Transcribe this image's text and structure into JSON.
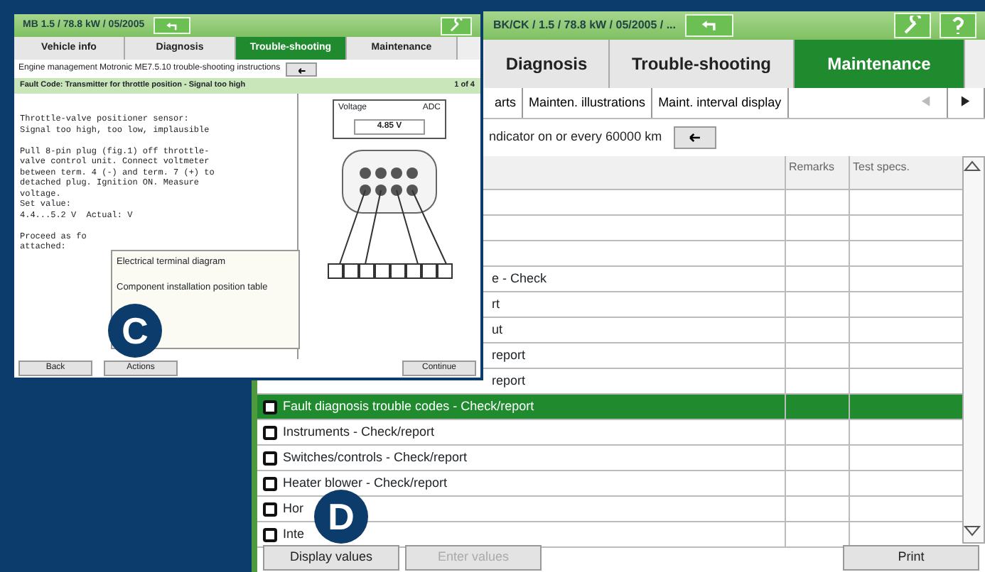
{
  "back_window": {
    "title": "BK/CK / 1.5 / 78.8 kW / 05/2005 / ...",
    "tabs": [
      {
        "label": "Diagnosis",
        "selected": false
      },
      {
        "label": "Trouble-shooting",
        "selected": false
      },
      {
        "label": "Maintenance",
        "selected": true
      }
    ],
    "subtabs": [
      {
        "label": "arts",
        "selected": false
      },
      {
        "label": "Mainten. illustrations",
        "selected": false
      },
      {
        "label": "Maint. interval display",
        "selected": false
      }
    ],
    "instruction": "ndicator on or every 60000 km",
    "table": {
      "columns": [
        "Remarks",
        "Test specs."
      ],
      "rows": [
        {
          "text": "e - Check",
          "partial": true,
          "selected": false
        },
        {
          "text": "rt",
          "partial": true,
          "selected": false
        },
        {
          "text": "ut",
          "partial": true,
          "selected": false
        },
        {
          "text": "report",
          "partial": true,
          "selected": false
        },
        {
          "text": "report",
          "partial": true,
          "selected": false
        },
        {
          "text": "Fault diagnosis trouble codes - Check/report",
          "partial": false,
          "selected": true
        },
        {
          "text": "Instruments - Check/report",
          "partial": false,
          "selected": false
        },
        {
          "text": "Switches/controls - Check/report",
          "partial": false,
          "selected": false
        },
        {
          "text": "Heater blower - Check/report",
          "partial": false,
          "selected": false
        },
        {
          "text": "Hor",
          "partial": false,
          "selected": false
        },
        {
          "text": "Inte",
          "partial": false,
          "selected": false
        }
      ]
    },
    "buttons": [
      {
        "label": "Display values",
        "disabled": false
      },
      {
        "label": "Enter values",
        "disabled": true
      },
      {
        "label": "Print",
        "disabled": false
      }
    ]
  },
  "front_window": {
    "title": "MB 1.5 / 78.8 kW / 05/2005",
    "tabs": [
      {
        "label": "Vehicle info",
        "selected": false
      },
      {
        "label": "Diagnosis",
        "selected": false
      },
      {
        "label": "Trouble-shooting",
        "selected": true
      },
      {
        "label": "Maintenance",
        "selected": false
      }
    ],
    "instruction": "Engine management Motronic ME7.5.10 trouble-shooting instructions",
    "fault_header": "Fault Code: Transmitter for throttle position - Signal too high",
    "page": "1 of 4",
    "body": [
      [
        "Throttle-valve positioner sensor:",
        "Signal too high, too low, implausible"
      ],
      [
        "Pull 8-pin plug (fig.1) off throttle-",
        "valve control unit. Connect voltmeter",
        "between term. 4 (-) and term. 7 (+) to",
        "detached plug. Ignition ON. Measure",
        "voltage.",
        "Set value:",
        "4.4...5.2 V  Actual: V"
      ],
      [
        "Proceed as fo",
        "attached:"
      ]
    ],
    "meter": {
      "label": "Voltage",
      "reading": "4.85 V",
      "unit": "ADC"
    },
    "menu": [
      "Electrical terminal diagram",
      "Component installation position table"
    ],
    "buttons": [
      "Back",
      "Actions",
      "Continue"
    ]
  },
  "markers": [
    "C",
    "D"
  ]
}
